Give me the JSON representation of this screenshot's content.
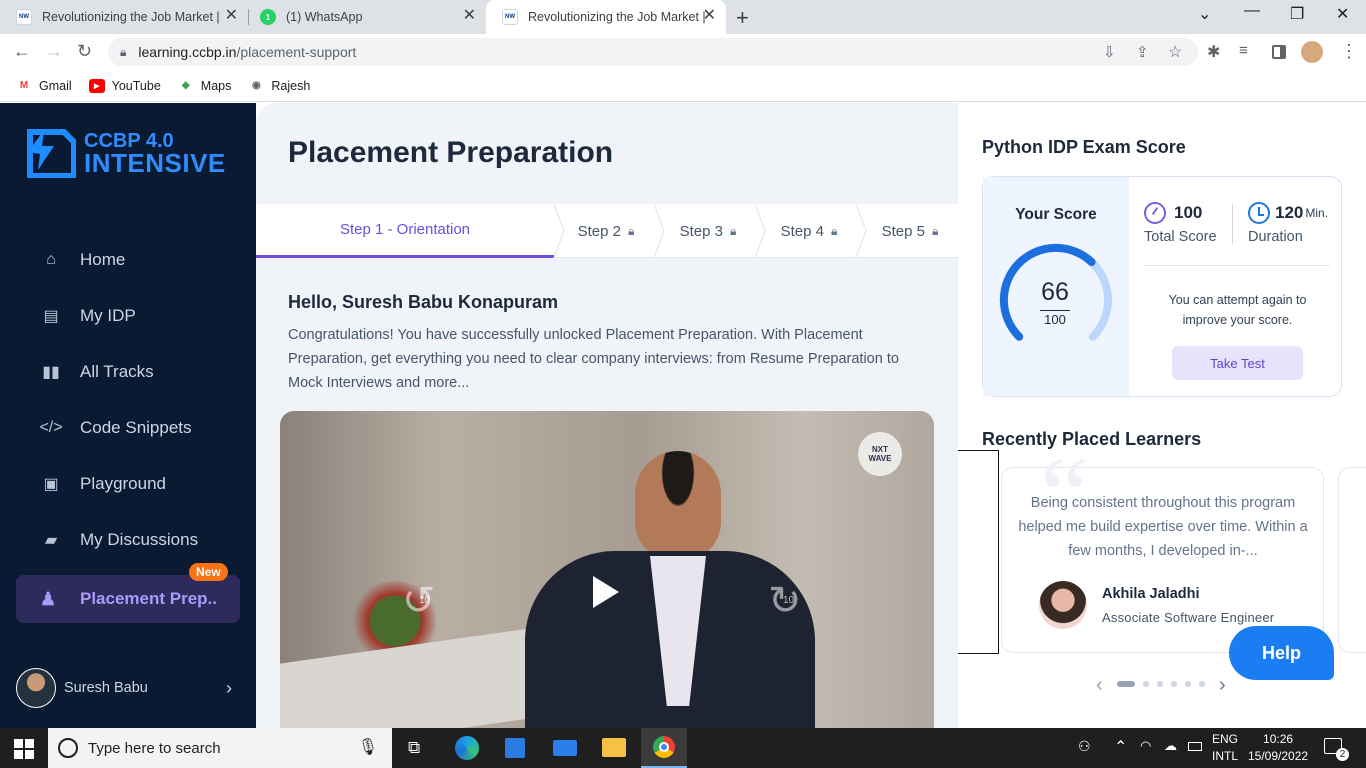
{
  "browser": {
    "tabs": [
      {
        "title": "Revolutionizing the Job Market |",
        "favicon": "nxtwave-favicon"
      },
      {
        "title": "(1) WhatsApp",
        "favicon": "whatsapp-favicon",
        "badge": "1"
      },
      {
        "title": "Revolutionizing the Job Market |",
        "favicon": "nxtwave-favicon",
        "active": true
      }
    ],
    "url_domain": "learning.ccbp.in",
    "url_path": "/placement-support",
    "bookmarks": [
      {
        "label": "Gmail",
        "icon": "gmail-icon"
      },
      {
        "label": "YouTube",
        "icon": "youtube-icon"
      },
      {
        "label": "Maps",
        "icon": "maps-icon"
      },
      {
        "label": "Rajesh",
        "icon": "globe-icon"
      }
    ]
  },
  "sidebar": {
    "logo_line1": "CCBP 4.0",
    "logo_line2": "INTENSIVE",
    "items": [
      {
        "label": "Home",
        "icon": "home-icon"
      },
      {
        "label": "My IDP",
        "icon": "document-icon"
      },
      {
        "label": "All Tracks",
        "icon": "book-icon"
      },
      {
        "label": "Code Snippets",
        "icon": "code-icon"
      },
      {
        "label": "Playground",
        "icon": "terminal-icon"
      },
      {
        "label": "My Discussions",
        "icon": "chat-icon"
      }
    ],
    "active_item": {
      "label": "Placement Prep..",
      "icon": "placement-icon",
      "badge": "New"
    },
    "user_name": "Suresh Babu"
  },
  "main": {
    "title": "Placement Preparation",
    "steps": [
      {
        "label": "Step 1 - Orientation",
        "locked": false,
        "active": true
      },
      {
        "label": "Step 2",
        "locked": true
      },
      {
        "label": "Step 3",
        "locked": true
      },
      {
        "label": "Step 4",
        "locked": true
      },
      {
        "label": "Step 5",
        "locked": true
      }
    ],
    "greeting": "Hello, Suresh Babu Konapuram",
    "intro": "Congratulations! You have successfully unlocked Placement Preparation. With Placement Preparation, get everything you need to clear company interviews: from Resume Preparation to Mock Interviews and more...",
    "video": {
      "rewind_label": "10",
      "forward_label": "10",
      "watermark": "NXT WAVE"
    }
  },
  "exam": {
    "title": "Python IDP Exam Score",
    "your_score_label": "Your Score",
    "score": "66",
    "score_total": "100",
    "score_fraction": 0.66,
    "total_score_value": "100",
    "total_score_label": "Total Score",
    "duration_value": "120",
    "duration_unit": "Min.",
    "duration_label": "Duration",
    "attempt_text": "You can attempt again to improve your score.",
    "take_test_label": "Take Test",
    "accent_color": "#1d6fe0"
  },
  "placed": {
    "title": "Recently Placed Learners",
    "quote": "Being consistent throughout this program helped me build expertise over time. Within a few months, I developed in-...",
    "name": "Akhila Jaladhi",
    "role": "Associate Software Engineer",
    "dots": 6,
    "active_dot": 0
  },
  "help_label": "Help",
  "taskbar": {
    "search_placeholder": "Type here to search",
    "lang_line1": "ENG",
    "lang_line2": "INTL",
    "time": "10:26",
    "date": "15/09/2022",
    "notifications": "2"
  }
}
